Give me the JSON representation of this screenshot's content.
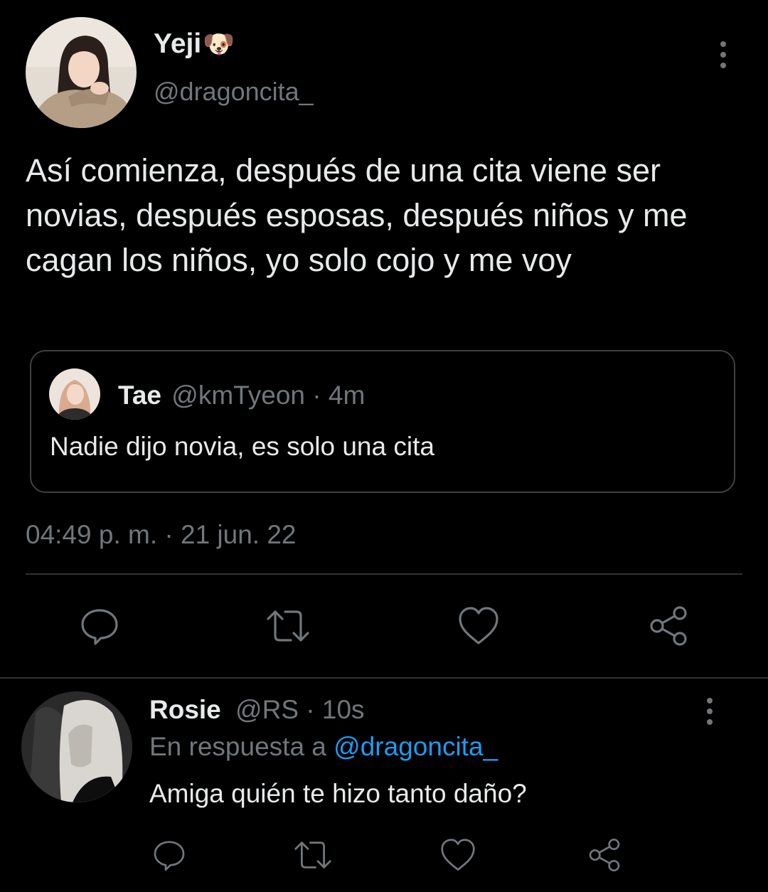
{
  "tweet": {
    "author_name": "Yeji",
    "author_emoji": "🐶",
    "author_handle": "@dragoncita_",
    "text": "Así comienza, después de una cita viene ser novias, después esposas, después niños y me cagan los niños, yo solo cojo y me voy",
    "timestamp": "04:49 p. m. · 21 jun. 22",
    "quote": {
      "name": "Tae",
      "handle": "@kmTyeon",
      "sep": "·",
      "time": "4m",
      "text": "Nadie dijo novia, es solo una cita"
    }
  },
  "reply": {
    "name": "Rosie",
    "handle": "@RS",
    "sep": "·",
    "time": "10s",
    "in_reply_prefix": "En respuesta a",
    "in_reply_handle": "@dragoncita_",
    "text": "Amiga quién te hizo tanto daño?"
  },
  "actions": [
    "reply-icon",
    "retweet-icon",
    "like-icon",
    "share-icon"
  ],
  "colors": {
    "background": "#000000",
    "text": "#e7e9ea",
    "muted": "#71767b",
    "link": "#1d9bf0",
    "divider": "#2f3336"
  }
}
